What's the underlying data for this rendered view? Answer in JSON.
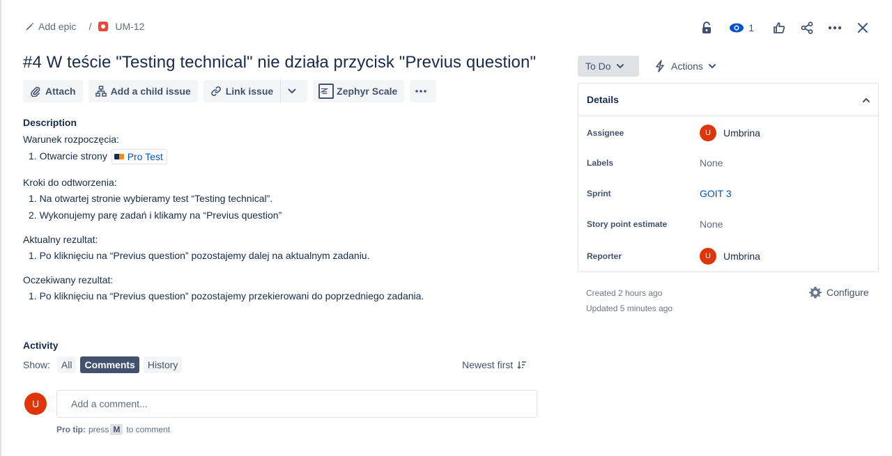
{
  "breadcrumb": {
    "epic_label": "Add epic",
    "separator": "/",
    "issue_key": "UM-12"
  },
  "header": {
    "watch_count": "1"
  },
  "title": "#4 W teście \"Testing technical\" nie działa przycisk \"Previus question\"",
  "toolbar": {
    "attach": "Attach",
    "child_issue": "Add a child issue",
    "link_issue": "Link issue",
    "zephyr": "Zephyr Scale"
  },
  "description": {
    "heading": "Description",
    "precondition_label": "Warunek rozpoczęcia:",
    "precondition_item": "1. Otwarcie strony",
    "precondition_link": "Pro Test",
    "steps_label": "Kroki do odtworzenia:",
    "steps": [
      "1. Na otwartej stronie wybieramy test “Testing technical”.",
      "2. Wykonujemy parę zadań i klikamy na “Previus question”"
    ],
    "actual_label": "Aktualny rezultat:",
    "actual": [
      "1. Po kliknięciu na “Previus question” pozostajemy dalej na aktualnym zadaniu."
    ],
    "expected_label": "Oczekiwany rezultat:",
    "expected": [
      "1. Po kliknięciu na “Previus question” pozostajemy przekierowani do poprzedniego zadania."
    ]
  },
  "activity": {
    "heading": "Activity",
    "show_label": "Show:",
    "filters": [
      "All",
      "Comments",
      "History"
    ],
    "active_filter": "Comments",
    "sort": "Newest first",
    "avatar_letter": "U",
    "comment_placeholder": "Add a comment...",
    "protip_bold": "Pro tip:",
    "protip_press": "press",
    "protip_key": "M",
    "protip_tail": "to comment"
  },
  "sidebar": {
    "status": "To Do",
    "actions": "Actions",
    "details_heading": "Details",
    "fields": {
      "assignee_label": "Assignee",
      "assignee_value": "Umbrina",
      "labels_label": "Labels",
      "labels_value": "None",
      "sprint_label": "Sprint",
      "sprint_value": "GOIT 3",
      "estimate_label": "Story point estimate",
      "estimate_value": "None",
      "reporter_label": "Reporter",
      "reporter_value": "Umbrina",
      "avatar_letter": "U"
    },
    "created": "Created 2 hours ago",
    "updated": "Updated 5 minutes ago",
    "configure": "Configure"
  },
  "colors": {
    "accent": "#0052cc",
    "avatar": "#de350b",
    "bug": "#e5493a"
  }
}
